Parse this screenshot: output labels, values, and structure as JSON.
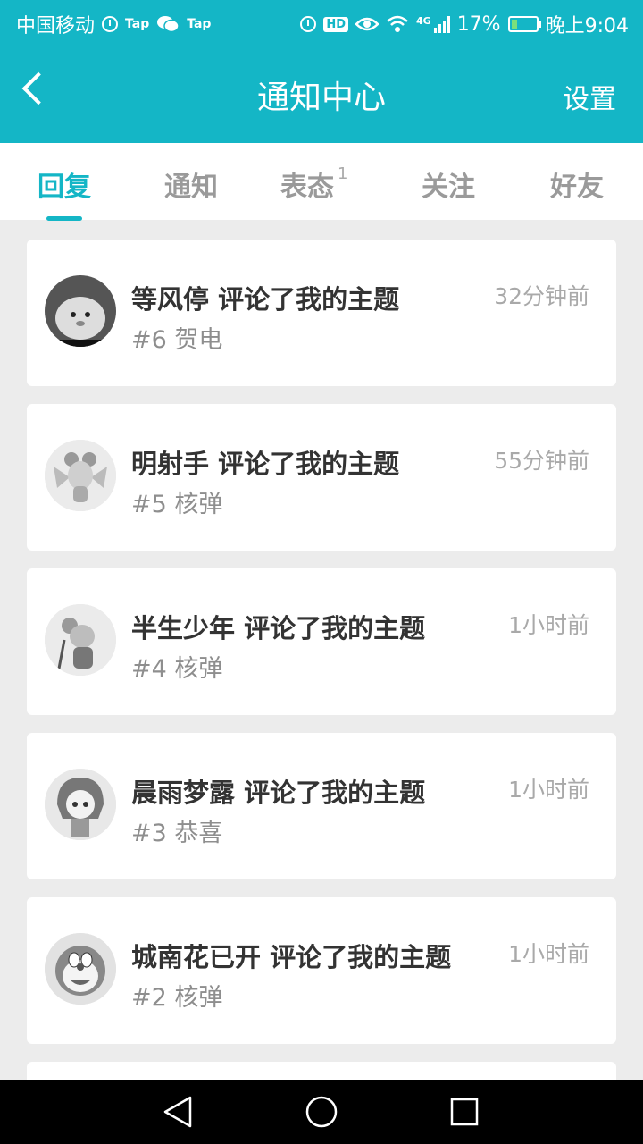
{
  "status_bar": {
    "carrier": "中国移动",
    "app_label_1": "Tap",
    "app_label_2": "Tap",
    "network": "4G",
    "battery": "17%",
    "time": "晚上9:04"
  },
  "header": {
    "title": "通知中心",
    "settings_label": "设置"
  },
  "tabs": [
    {
      "label": "回复",
      "active": true
    },
    {
      "label": "通知"
    },
    {
      "label": "表态",
      "badge": "1"
    },
    {
      "label": "关注"
    },
    {
      "label": "好友"
    }
  ],
  "notifications": [
    {
      "user": "等风停",
      "action": "评论了我的主题",
      "floor": "#6",
      "content": "贺电",
      "time": "32分钟前",
      "avatar_icon": "hamster-avatar"
    },
    {
      "user": "明射手",
      "action": "评论了我的主题",
      "floor": "#5",
      "content": "核弹",
      "time": "55分钟前",
      "avatar_icon": "winged-mouse-avatar"
    },
    {
      "user": "半生少年",
      "action": "评论了我的主题",
      "floor": "#4",
      "content": "核弹",
      "time": "1小时前",
      "avatar_icon": "mouse-avatar"
    },
    {
      "user": "晨雨梦露",
      "action": "评论了我的主题",
      "floor": "#3",
      "content": "恭喜",
      "time": "1小时前",
      "avatar_icon": "anime-girl-avatar"
    },
    {
      "user": "城南花已开",
      "action": "评论了我的主题",
      "floor": "#2",
      "content": "核弹",
      "time": "1小时前",
      "avatar_icon": "doraemon-avatar"
    }
  ],
  "colors": {
    "accent": "#14b6c6",
    "background": "#ececec"
  }
}
